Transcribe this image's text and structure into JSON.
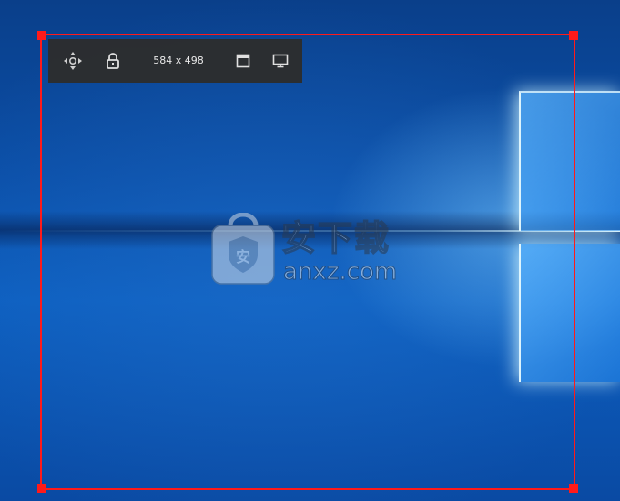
{
  "toolbar": {
    "size_readout": "584 x 498",
    "tools": [
      {
        "name": "move",
        "icon": "move-icon"
      },
      {
        "name": "lock",
        "icon": "unlock-icon"
      },
      {
        "name": "window",
        "icon": "window-icon"
      },
      {
        "name": "fullscreen",
        "icon": "monitor-icon"
      }
    ]
  },
  "watermark": {
    "title": "安下载",
    "domain": "anxz.com",
    "logo_glyph": "安",
    "logo_icon": "shopping-bag-shield-icon"
  },
  "colors": {
    "frame": "#ff1a1a",
    "toolbar_bg": "#2d2d2d",
    "toolbar_text": "#e8e8e8",
    "wallpaper": "#0b4fa8"
  }
}
